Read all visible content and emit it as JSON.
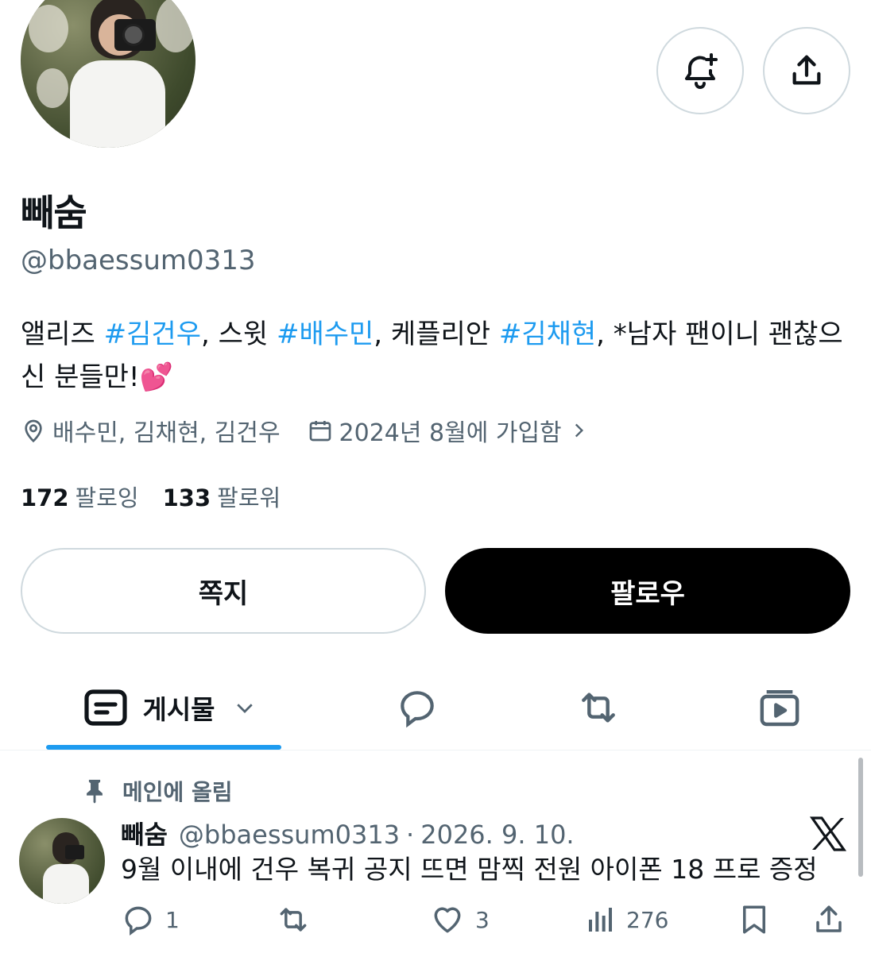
{
  "profile": {
    "display_name": "빼숨",
    "handle": "@bbaessum0313",
    "bio": {
      "p1": "앨리즈 ",
      "tag1": "#김건우",
      "p2": ", 스윗 ",
      "tag2": "#배수민",
      "p3": ", 케플리안 ",
      "tag3": "#김채현",
      "p4": ", *남자 팬이니 괜찮으신 분들만!",
      "emoji": "💕"
    },
    "location": "배수민, 김채현, 김건우",
    "joined": "2024년 8월에 가입함",
    "following_count": "172",
    "following_label": "팔로잉",
    "followers_count": "133",
    "followers_label": "팔로워"
  },
  "header_actions": {
    "notify_icon": "bell-plus-icon",
    "share_icon": "share-icon"
  },
  "buttons": {
    "message": "쪽지",
    "follow": "팔로우"
  },
  "tabs": {
    "posts_label": "게시물",
    "icons": [
      "posts-icon",
      "reply-icon",
      "repost-icon",
      "media-icon"
    ]
  },
  "pinned_post": {
    "pinned_label": "메인에 올림",
    "author_name": "빼숨",
    "author_handle": "@bbaessum0313",
    "separator": "·",
    "date": "2026. 9. 10.",
    "text": "9월 이내에 건우 복귀 공지 뜨면 맘찍 전원 아이폰 18 프로 증정",
    "replies": "1",
    "reposts": "",
    "likes": "3",
    "views": "276"
  },
  "colors": {
    "accent": "#1d9bf0",
    "text_primary": "#0f1419",
    "text_secondary": "#536471",
    "border": "#cfd9de",
    "follow_bg": "#000000"
  }
}
